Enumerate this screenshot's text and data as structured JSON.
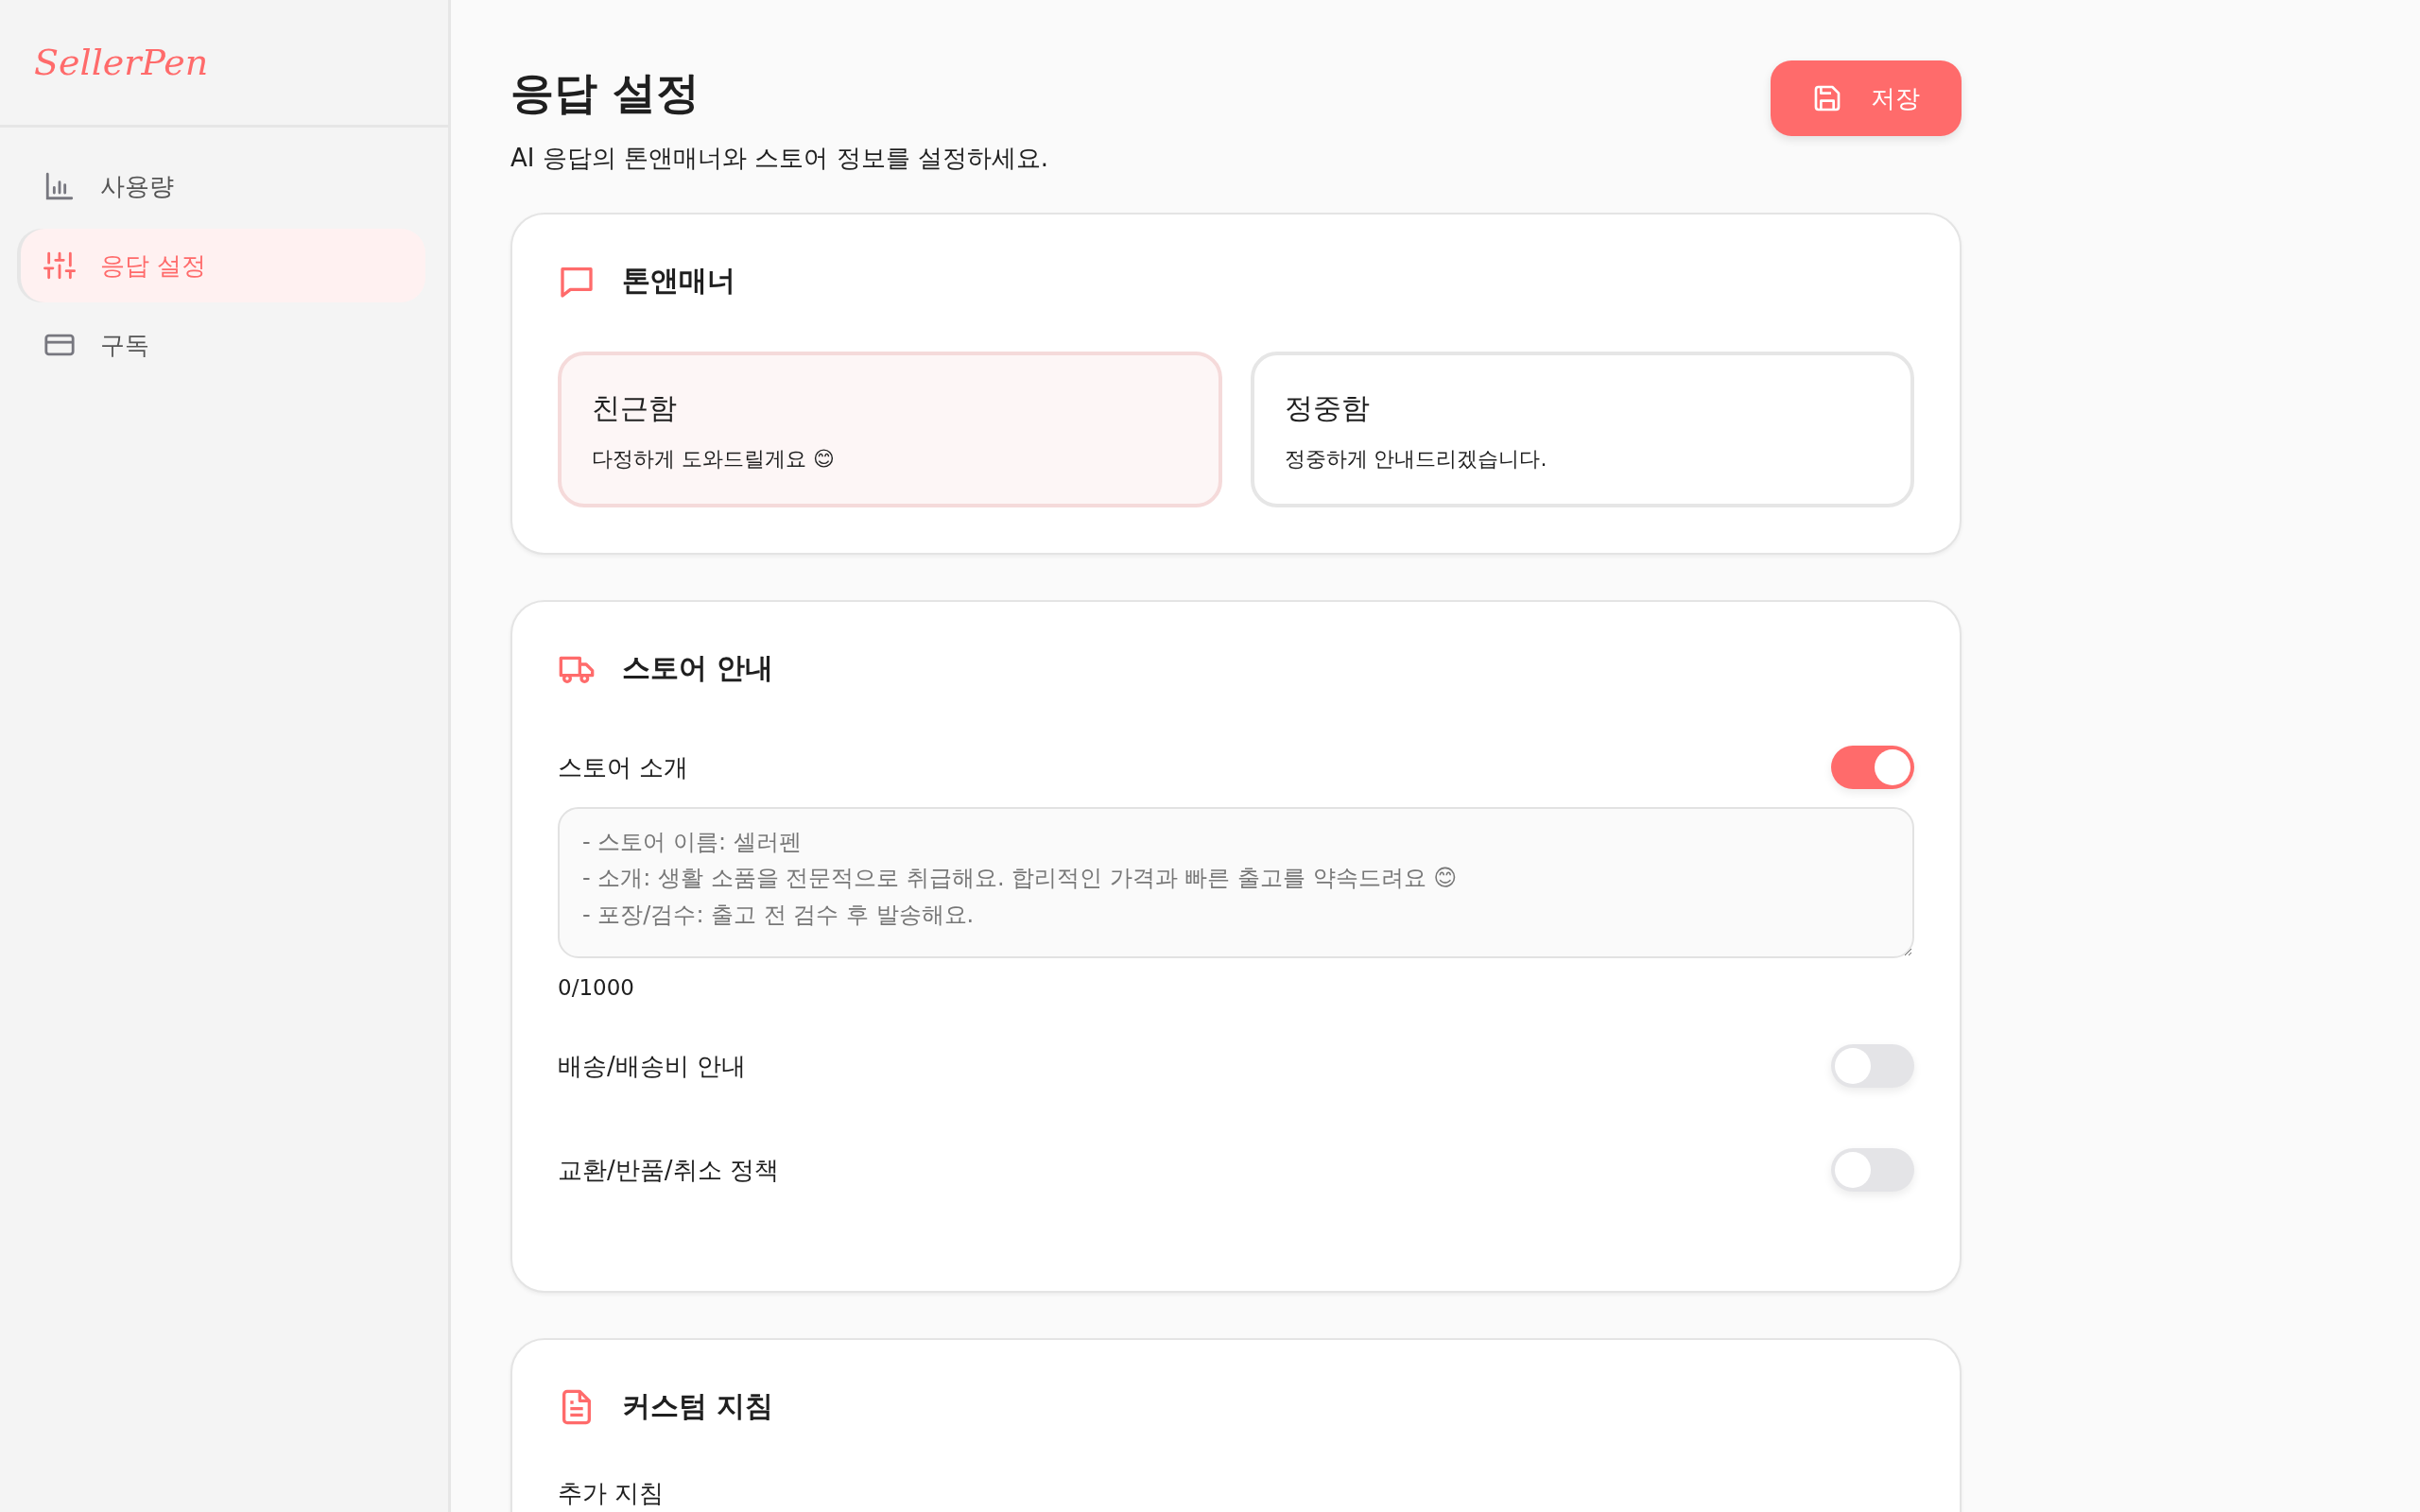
{
  "sidebar": {
    "logo": "SellerPen",
    "items": [
      {
        "label": "사용량",
        "selected": false
      },
      {
        "label": "응답 설정",
        "selected": true
      },
      {
        "label": "구독",
        "selected": false
      }
    ]
  },
  "header": {
    "title": "응답 설정",
    "subtitle": "AI 응답의 톤앤매너와 스토어 정보를 설정하세요.",
    "save_button": "저장"
  },
  "tone": {
    "title": "톤앤매너",
    "options": [
      {
        "label": "친근함",
        "description": "다정하게 도와드릴게요 😊",
        "selected": true
      },
      {
        "label": "정중함",
        "description": "정중하게 안내드리겠습니다.",
        "selected": false
      }
    ]
  },
  "store": {
    "title": "스토어 안내",
    "sections": [
      {
        "label": "스토어 소개",
        "on": true,
        "placeholder": "- 스토어 이름: 셀러펜\n- 소개: 생활 소품을 전문적으로 취급해요. 합리적인 가격과 빠른 출고를 약속드려요 😊\n- 포장/검수: 출고 전 검수 후 발송해요.",
        "counter": "0/1000"
      },
      {
        "label": "배송/배송비 안내",
        "on": false
      },
      {
        "label": "교환/반품/취소 정책",
        "on": false
      }
    ]
  },
  "custom": {
    "title": "커스텀 지침",
    "field_label": "추가 지침"
  }
}
